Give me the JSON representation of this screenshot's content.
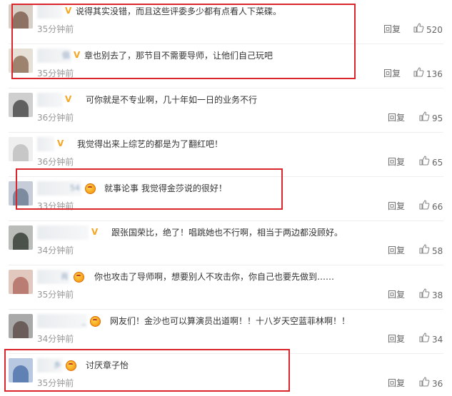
{
  "comments": [
    {
      "text": "说得其实没错，而且这些评委多少都有点看人下菜碟。",
      "time": "35分钟前",
      "reply": "回复",
      "likes": "520",
      "name_tail": "",
      "badge": "v",
      "avatar": [
        "#d8cfc6",
        "#7a5a4a"
      ]
    },
    {
      "text": "章也别去了，那节目不需要导师，让他们自己玩吧",
      "time": "35分钟前",
      "reply": "回复",
      "likes": "136",
      "name_tail": "倡",
      "badge": "v",
      "avatar": [
        "#e6e0d7",
        "#8b6b52"
      ]
    },
    {
      "text": "可你就是不专业啊，几十年如一日的业务不行",
      "time": "36分钟前",
      "reply": "回复",
      "likes": "95",
      "name_tail": "",
      "badge": "v",
      "avatar": [
        "#cfcfcf",
        "#444444"
      ]
    },
    {
      "text": "我觉得出来上综艺的都是为了翻红吧！",
      "time": "36分钟前",
      "reply": "回复",
      "likes": "65",
      "name_tail": "",
      "badge": "v",
      "avatar": [
        "#efefef",
        "#bdbdbd"
      ]
    },
    {
      "text": "就事论事 我觉得金莎说的很好！",
      "time": "33分钟前",
      "reply": "回复",
      "likes": "66",
      "name_tail": "54",
      "badge": "crown",
      "avatar": [
        "#c6cdd8",
        "#6a7a92"
      ]
    },
    {
      "text": "跟张国荣比，绝了！唱跳她也不行啊，相当于两边都没顾好。",
      "time": "34分钟前",
      "reply": "回复",
      "likes": "58",
      "name_tail": "",
      "badge": "v",
      "avatar": [
        "#b9bcb8",
        "#2f3630"
      ]
    },
    {
      "text": "你也攻击了导师啊，想要别人不攻击你，你自己也要先做到……",
      "time": "35分钟前",
      "reply": "回复",
      "likes": "38",
      "name_tail": "肖",
      "badge": "crown",
      "avatar": [
        "#e2c9c0",
        "#b06a60"
      ]
    },
    {
      "text": "网友们！金沙也可以算演员出道啊！！十八岁天空蓝菲林啊！！",
      "time": "34分钟前",
      "reply": "回复",
      "likes": "34",
      "name_tail": "_",
      "badge": "crown",
      "avatar": [
        "#a9a9a9",
        "#5a4a46"
      ]
    },
    {
      "text": "讨厌章子怡",
      "time": "35分钟前",
      "reply": "回复",
      "likes": "36",
      "name_tail": "乡",
      "badge": "crown",
      "avatar": [
        "#b8c8e0",
        "#4a6fa8"
      ]
    }
  ],
  "colors": {
    "highlight": "#d9252b",
    "vip": "#f5a623",
    "time": "#999999"
  }
}
